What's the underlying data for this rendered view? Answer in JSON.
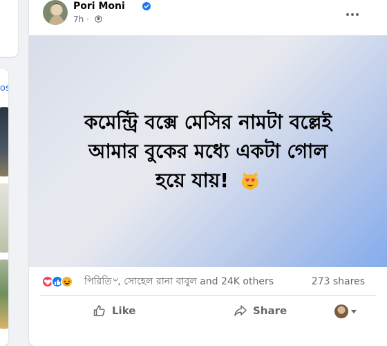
{
  "sidebar": {
    "link_fragment": "os"
  },
  "post": {
    "author": "Pori Moni",
    "time": "7h",
    "text_lines": [
      "কমেন্ট্রি বক্সে মেসির নামটা বল্লেই",
      "আমার বুকের মধ্যে একটা গোল",
      "হয়ে যায়!"
    ],
    "emoji_icon": "heart-eyes-cat-icon",
    "reactions": [
      "love",
      "like",
      "haha"
    ],
    "reactors_text": "পিরিতি৺, সোহেল রানা বাবুল and 24K others",
    "shares_text": "273 shares",
    "like_label": "Like",
    "share_label": "Share"
  },
  "colors": {
    "accent": "#1877f2",
    "love": "#f33e58",
    "haha": "#f7b125",
    "muted_text": "#65676b"
  }
}
